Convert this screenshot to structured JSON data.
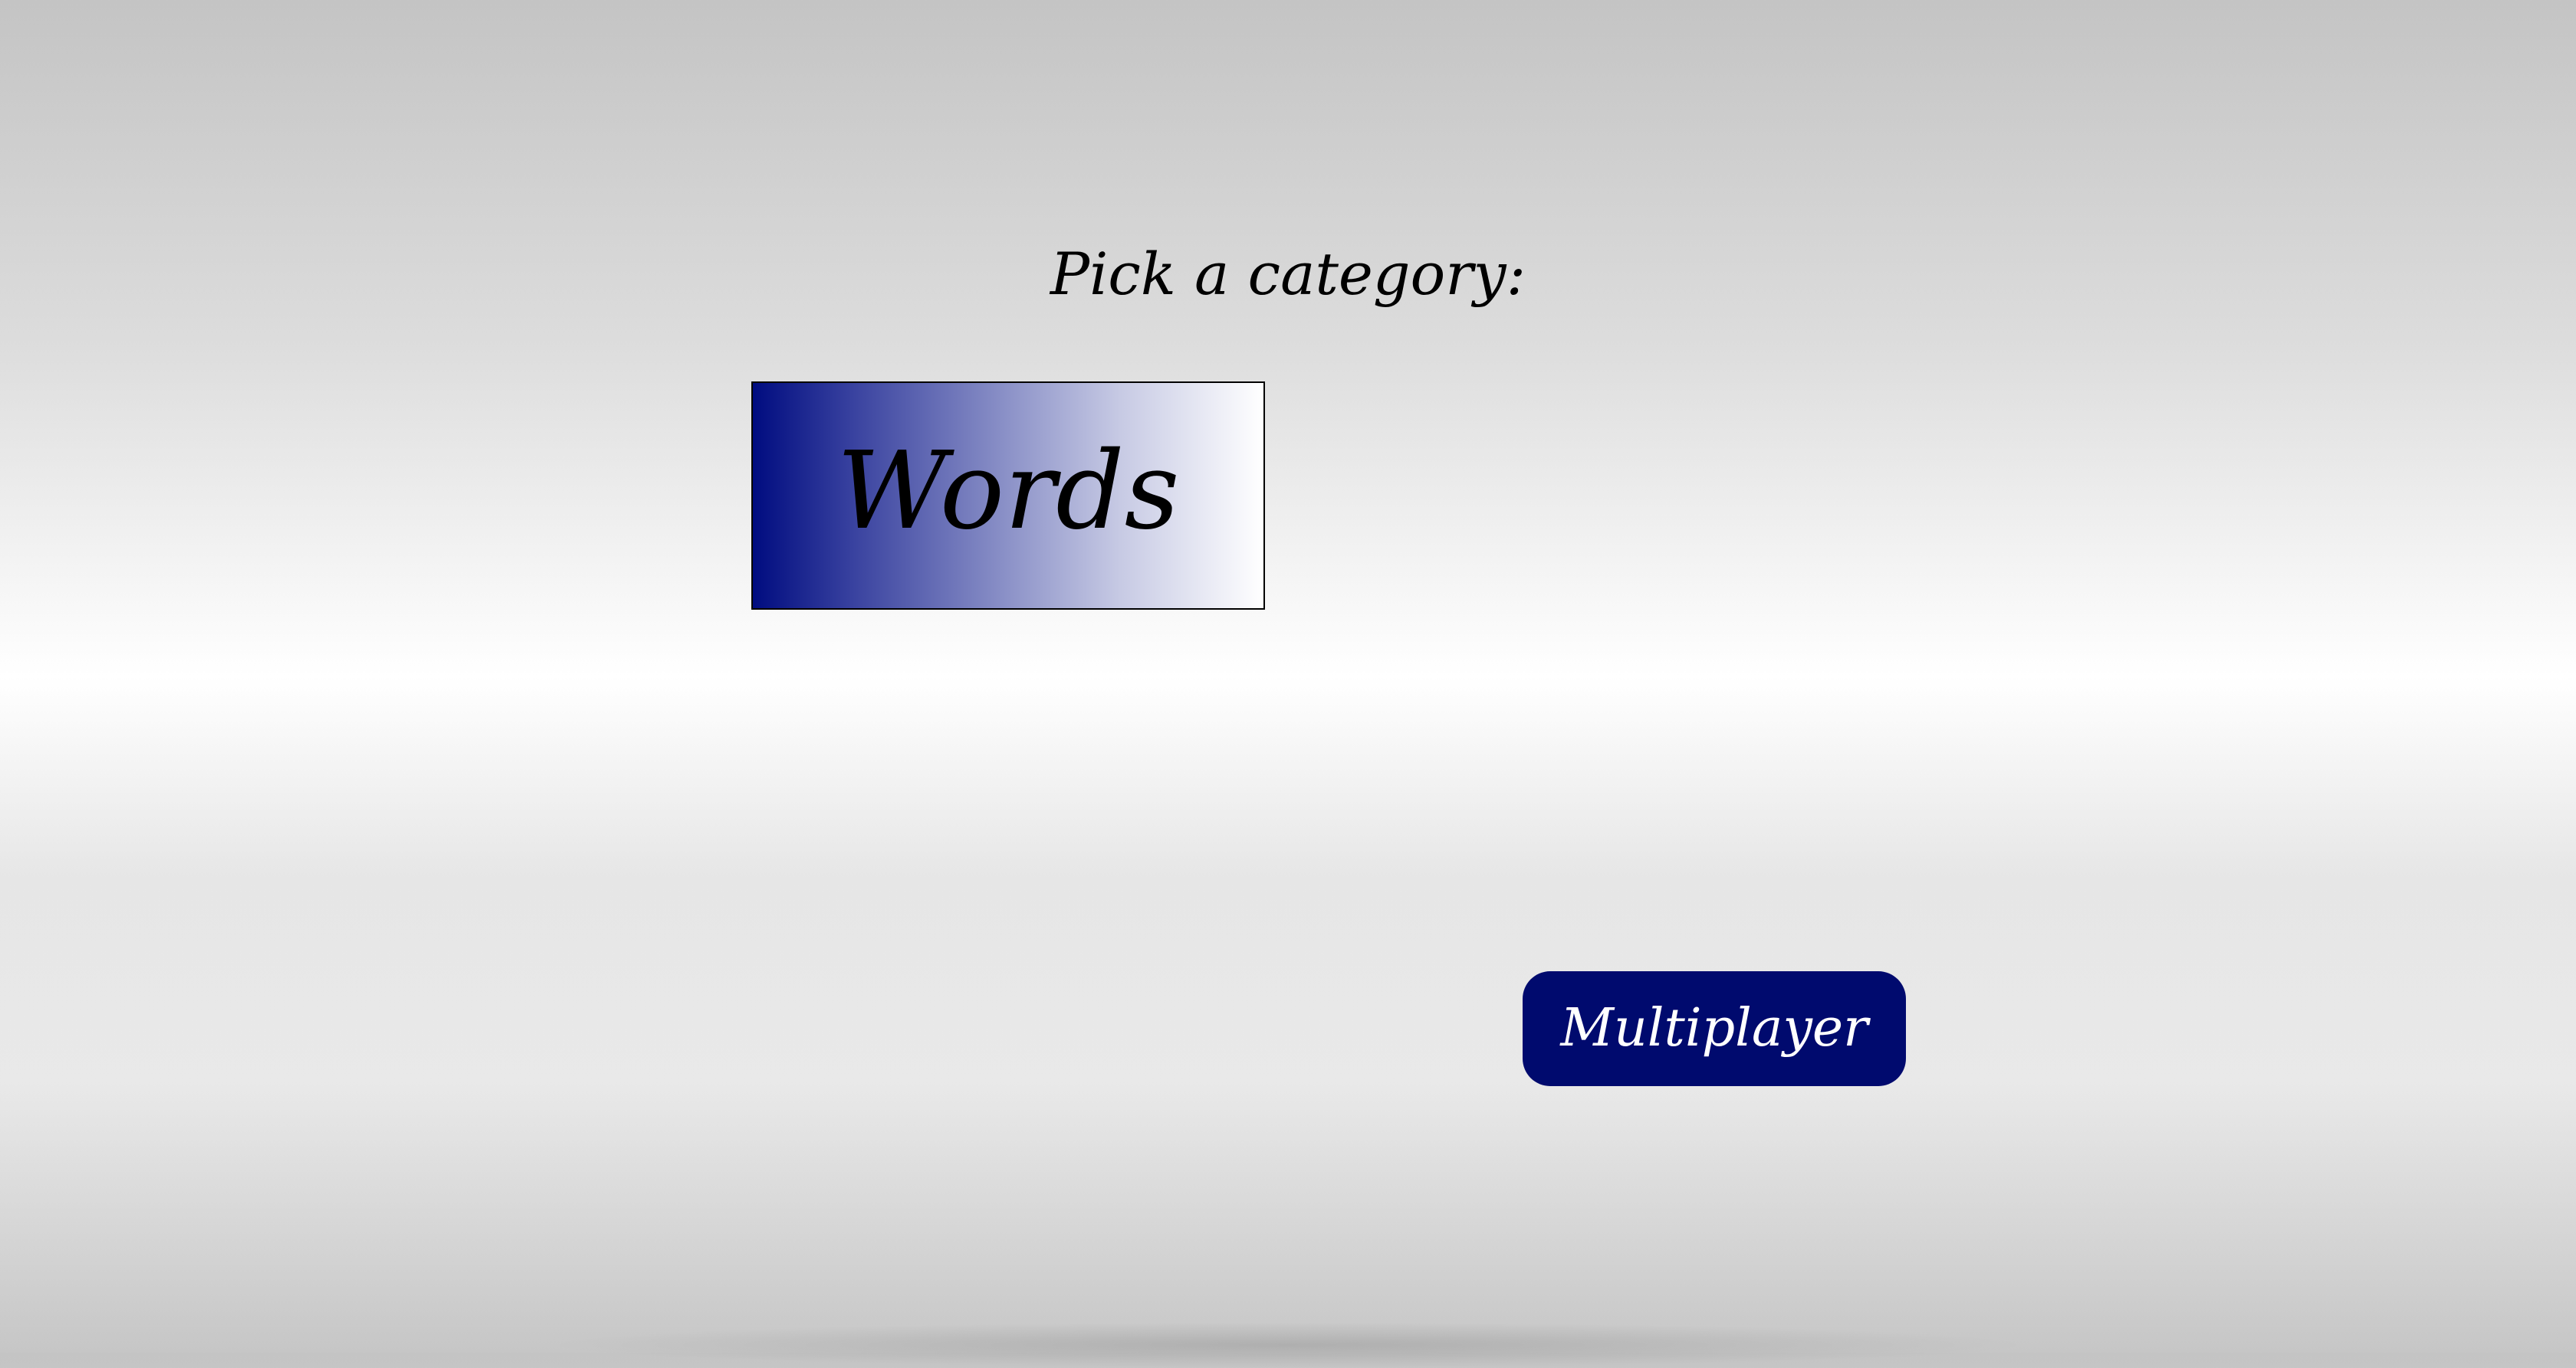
{
  "header": {
    "title": "Pick a category:"
  },
  "categories": [
    {
      "label": "Words"
    }
  ],
  "actions": {
    "multiplayer_label": "Multiplayer"
  },
  "colors": {
    "accent": "#000a6e",
    "category_gradient_start": "#000c80",
    "category_gradient_end": "#ffffff"
  }
}
